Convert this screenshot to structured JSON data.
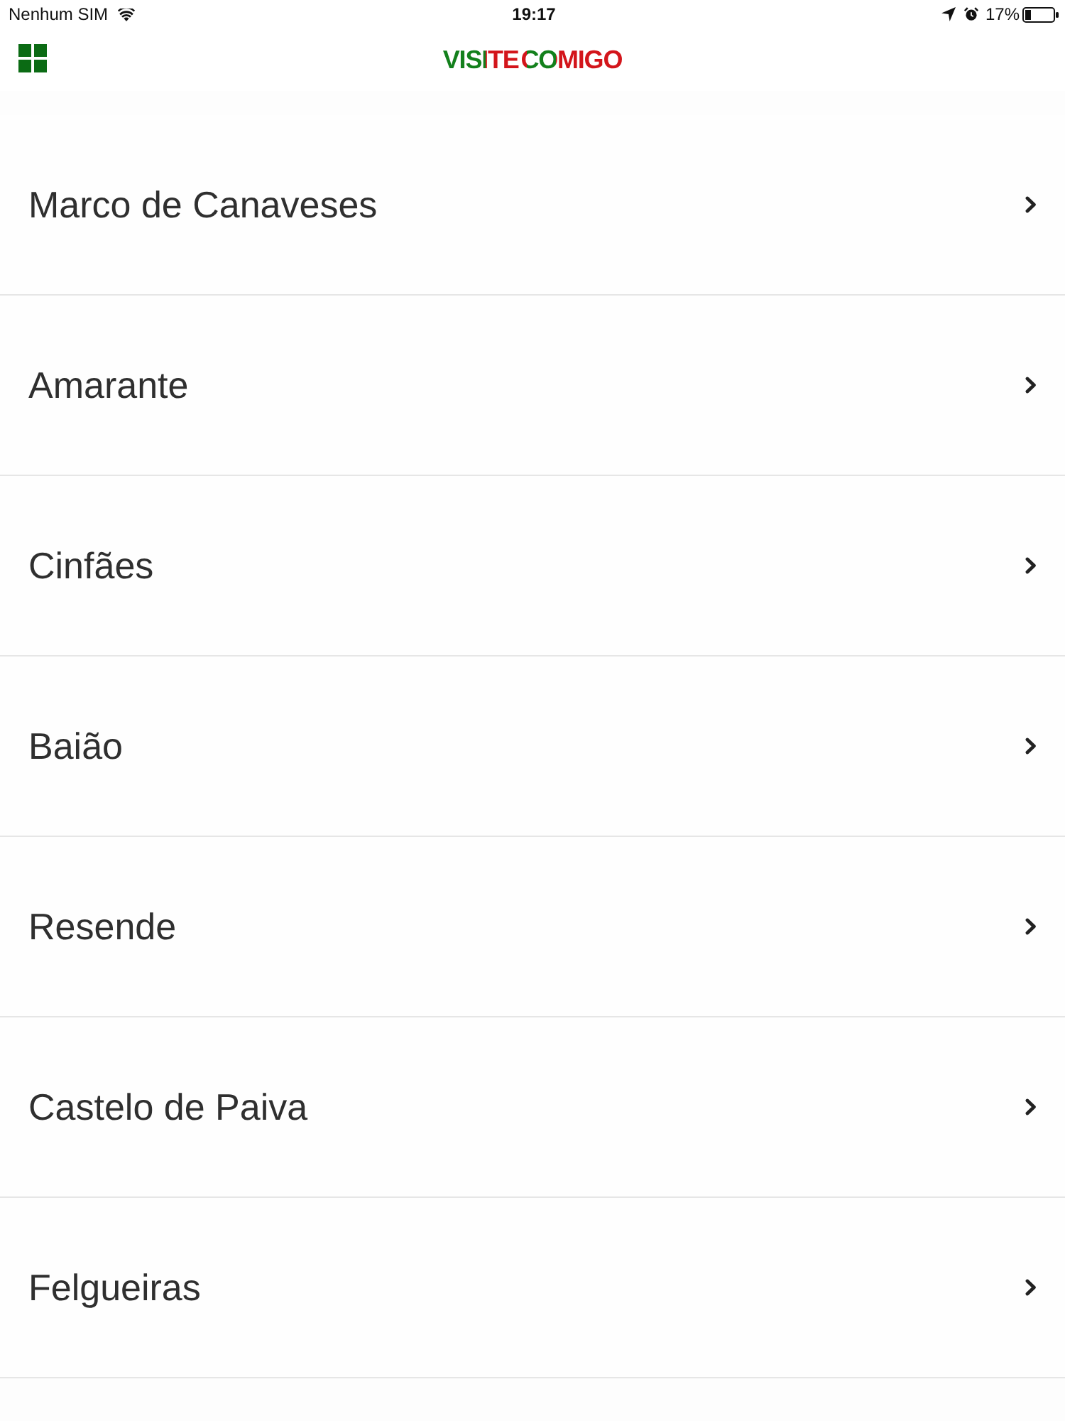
{
  "status_bar": {
    "carrier": "Nenhum SIM",
    "time": "19:17",
    "battery_percent": "17%"
  },
  "header": {
    "logo": "VISITE COMIGO"
  },
  "list": {
    "items": [
      {
        "label": "Marco de Canaveses"
      },
      {
        "label": "Amarante"
      },
      {
        "label": "Cinfães"
      },
      {
        "label": "Baião"
      },
      {
        "label": "Resende"
      },
      {
        "label": "Castelo de Paiva"
      },
      {
        "label": "Felgueiras"
      }
    ]
  }
}
